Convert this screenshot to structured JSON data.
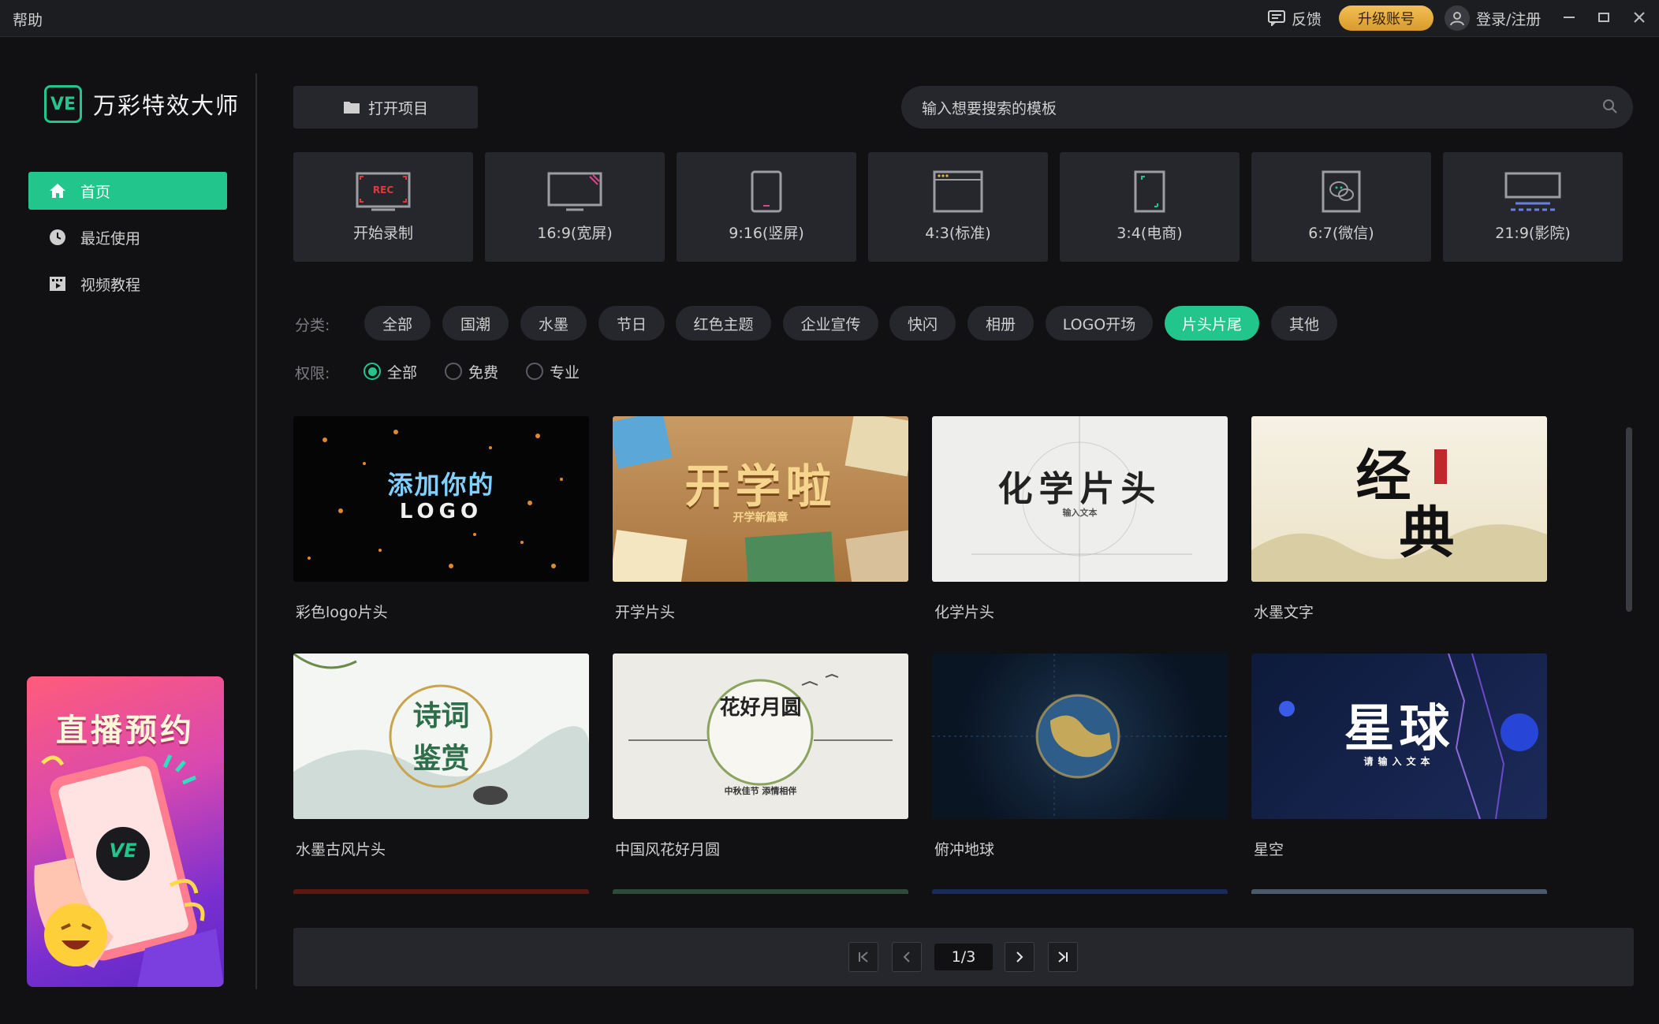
{
  "titlebar": {
    "help": "帮助",
    "feedback": "反馈",
    "upgrade": "升级账号",
    "login": "登录/注册"
  },
  "app": {
    "logo_badge": "VE",
    "name": "万彩特效大师"
  },
  "sidebar": {
    "items": [
      {
        "label": "首页",
        "icon": "home-icon",
        "active": true
      },
      {
        "label": "最近使用",
        "icon": "clock-icon",
        "active": false
      },
      {
        "label": "视频教程",
        "icon": "film-icon",
        "active": false
      }
    ],
    "promo": {
      "title": "直播预约",
      "badge": "VE"
    }
  },
  "toolbar": {
    "open_project": "打开项目",
    "search_placeholder": "输入想要搜索的模板"
  },
  "ratios": [
    {
      "label": "开始录制",
      "icon": "record-icon",
      "rec_text": "REC"
    },
    {
      "label": "16:9(宽屏)",
      "icon": "widescreen-icon"
    },
    {
      "label": "9:16(竖屏)",
      "icon": "portrait-phone-icon"
    },
    {
      "label": "4:3(标准)",
      "icon": "standard-screen-icon"
    },
    {
      "label": "3:4(电商)",
      "icon": "ecommerce-icon"
    },
    {
      "label": "6:7(微信)",
      "icon": "wechat-icon"
    },
    {
      "label": "21:9(影院)",
      "icon": "cinema-icon"
    }
  ],
  "filters": {
    "category_label": "分类:",
    "categories": [
      "全部",
      "国潮",
      "水墨",
      "节日",
      "红色主题",
      "企业宣传",
      "快闪",
      "相册",
      "LOGO开场",
      "片头片尾",
      "其他"
    ],
    "active_category": "片头片尾",
    "permission_label": "权限:",
    "permissions": [
      "全部",
      "免费",
      "专业"
    ],
    "active_permission": "全部"
  },
  "templates": [
    {
      "title": "彩色logo片头",
      "thumb_line1": "添加你的",
      "thumb_line2": "LOGO"
    },
    {
      "title": "开学片头",
      "thumb_line1": "开学啦",
      "thumb_line2": "开学新篇章"
    },
    {
      "title": "化学片头",
      "thumb_line1": "化学片头",
      "thumb_line2": "输入文本"
    },
    {
      "title": "水墨文字",
      "thumb_line1": "经",
      "thumb_line2": "典"
    },
    {
      "title": "水墨古风片头",
      "thumb_line1": "诗词",
      "thumb_line2": "鉴赏"
    },
    {
      "title": "中国风花好月圆",
      "thumb_line1": "花好月圆",
      "thumb_line2": "中秋佳节 添情相伴"
    },
    {
      "title": "俯冲地球",
      "thumb_line1": "",
      "thumb_line2": ""
    },
    {
      "title": "星空",
      "thumb_line1": "星球",
      "thumb_line2": "请输入文本"
    }
  ],
  "pagination": {
    "current": "1/3"
  },
  "colors": {
    "accent": "#22c58b",
    "upgrade": "#e9ad3d",
    "panel": "#26272c",
    "background": "#111113"
  }
}
